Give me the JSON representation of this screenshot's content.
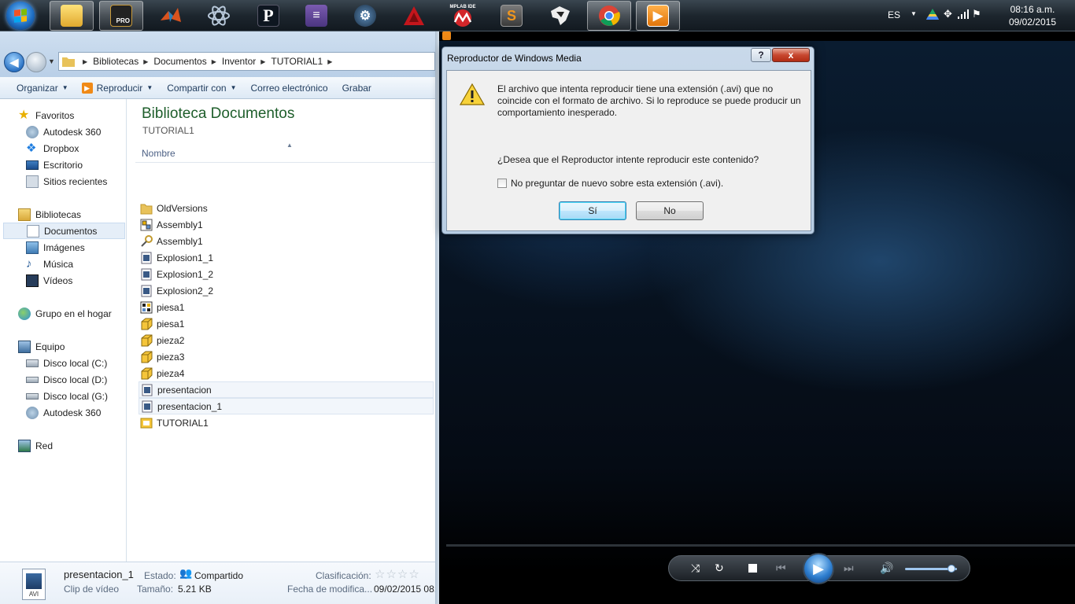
{
  "taskbar": {
    "apps": [
      {
        "name": "explorer",
        "color": "#f0c84a"
      },
      {
        "name": "inventor-pro",
        "color": "#c89a3a"
      },
      {
        "name": "matlab",
        "color": "#d9531e"
      },
      {
        "name": "atom-app",
        "color": "#9ab0c8"
      },
      {
        "name": "p-app",
        "color": "#1c2a3a"
      },
      {
        "name": "mixer-app",
        "color": "#6a4f9c"
      },
      {
        "name": "steam",
        "color": "#2a4c6e"
      },
      {
        "name": "autocad",
        "color": "#c4161c"
      },
      {
        "name": "mplab-ide",
        "color": "#d3262a"
      },
      {
        "name": "sublime-text",
        "color": "#4a4a4a"
      },
      {
        "name": "inkscape",
        "color": "#2d2d2d"
      },
      {
        "name": "chrome",
        "color": "#3b8b3b"
      },
      {
        "name": "windows-media-player",
        "color": "#f08a17"
      }
    ],
    "mplab_label": "MPLAB IDE",
    "pro_label": "PRO",
    "lang": "ES",
    "time": "08:16 a.m.",
    "date": "09/02/2015"
  },
  "explorer": {
    "breadcrumb": [
      "Bibliotecas",
      "Documentos",
      "Inventor",
      "TUTORIAL1"
    ],
    "commands": [
      "Organizar",
      "Reproducir",
      "Compartir con",
      "Correo electrónico",
      "Grabar"
    ],
    "sidebar": {
      "favorites_header": "Favoritos",
      "favorites": [
        "Autodesk 360",
        "Dropbox",
        "Escritorio",
        "Sitios recientes"
      ],
      "libraries_header": "Bibliotecas",
      "libraries": [
        "Documentos",
        "Imágenes",
        "Música",
        "Vídeos"
      ],
      "homegroup": "Grupo en el hogar",
      "computer_header": "Equipo",
      "drives": [
        "Disco local (C:)",
        "Disco local (D:)",
        "Disco local (G:)",
        "Autodesk 360"
      ],
      "network": "Red"
    },
    "title": "Biblioteca Documentos",
    "subtitle": "TUTORIAL1",
    "column_name": "Nombre",
    "files": [
      {
        "name": "OldVersions",
        "icon": "folder-icon"
      },
      {
        "name": "Assembly1",
        "icon": "assembly-icon"
      },
      {
        "name": "Assembly1",
        "icon": "presentation-key-icon"
      },
      {
        "name": "Explosion1_1",
        "icon": "video-file-icon"
      },
      {
        "name": "Explosion1_2",
        "icon": "video-file-icon"
      },
      {
        "name": "Explosion2_2",
        "icon": "video-file-icon"
      },
      {
        "name": "piesa1",
        "icon": "drawing-icon"
      },
      {
        "name": "piesa1",
        "icon": "part-icon"
      },
      {
        "name": "pieza2",
        "icon": "part-icon"
      },
      {
        "name": "pieza3",
        "icon": "part-icon"
      },
      {
        "name": "pieza4",
        "icon": "part-icon"
      },
      {
        "name": "presentacion",
        "icon": "video-file-icon"
      },
      {
        "name": "presentacion_1",
        "icon": "video-file-icon"
      },
      {
        "name": "TUTORIAL1",
        "icon": "project-icon"
      }
    ],
    "details": {
      "filename": "presentacion_1",
      "type": "Clip de vídeo",
      "icon_label": "AVI",
      "state_label": "Estado:",
      "state_value": "Compartido",
      "size_label": "Tamaño:",
      "size_value": "5.21 KB",
      "rating_label": "Clasificación:",
      "modified_label": "Fecha de modifica...",
      "modified_value": "09/02/2015 08:"
    }
  },
  "dialog": {
    "title": "Reproductor de Windows Media",
    "help": "?",
    "close": "x",
    "message": "El archivo que intenta reproducir tiene una extensión (.avi) que no coincide con el formato de archivo. Si lo reproduce se puede producir un comportamiento inesperado.",
    "question": "¿Desea que el Reproductor intente reproducir este contenido?",
    "checkbox_label": "No preguntar de nuevo sobre esta extensión (.avi).",
    "yes": "Sí",
    "no": "No"
  },
  "player": {
    "volume_level": 0.9,
    "icons": [
      "shuffle-icon",
      "repeat-icon",
      "stop-icon",
      "previous-icon",
      "play-icon",
      "next-icon",
      "volume-icon"
    ]
  },
  "colors": {
    "library_title": "#1e5e2b",
    "accent_blue": "#2f7fd0"
  }
}
